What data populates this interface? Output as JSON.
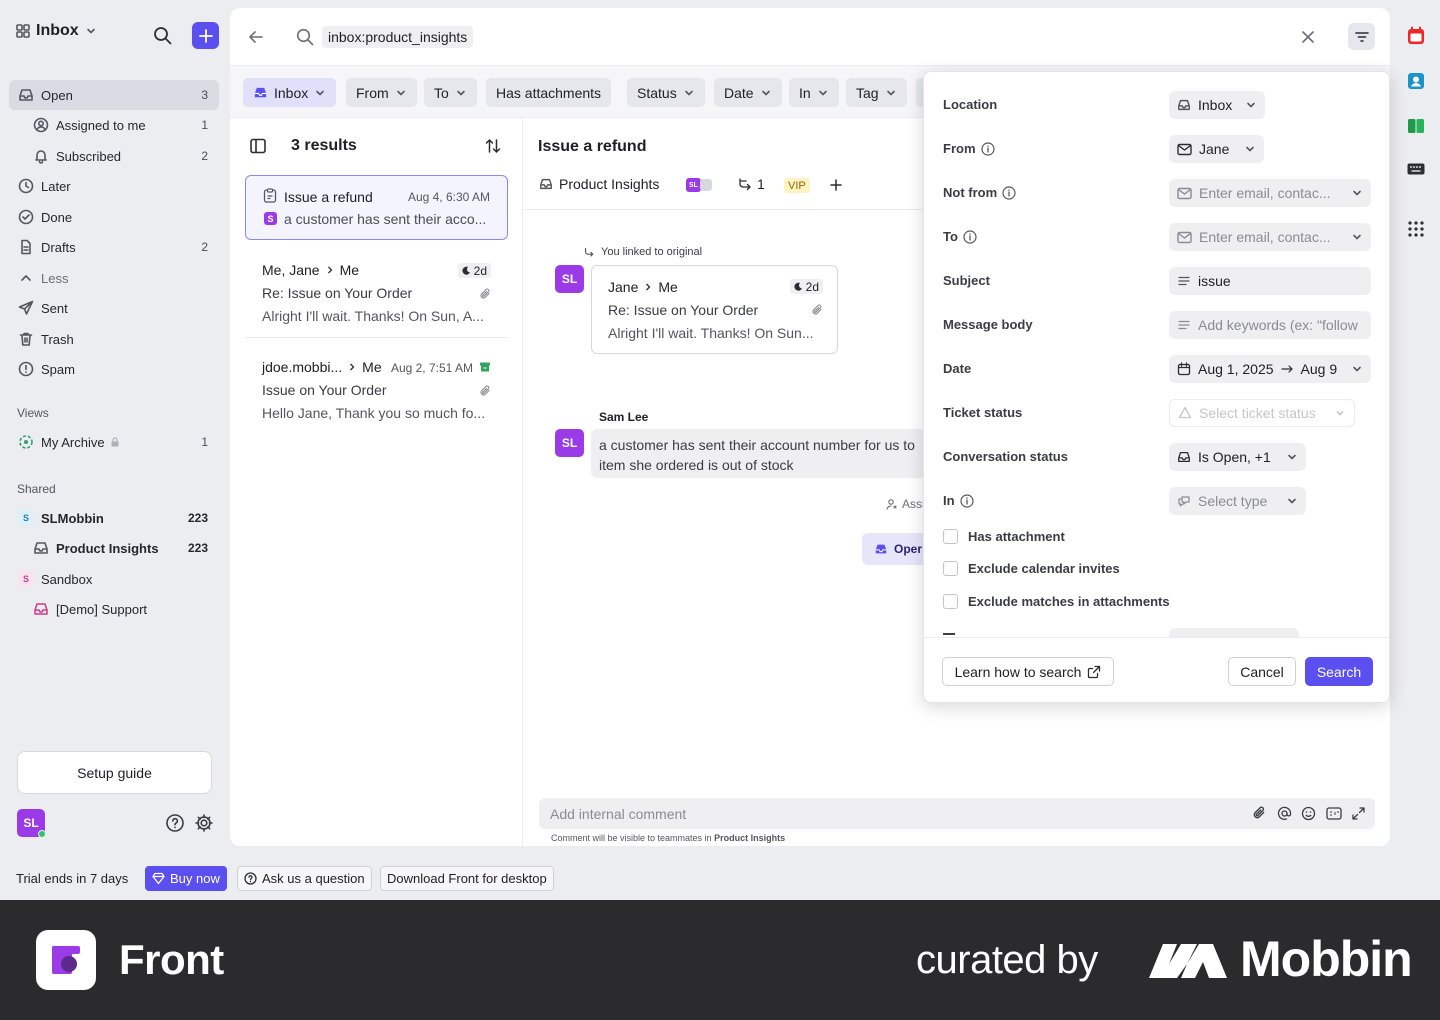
{
  "sidebar": {
    "title": "Inbox",
    "items": [
      {
        "label": "Open",
        "count": "3"
      },
      {
        "label": "Assigned to me",
        "count": "1"
      },
      {
        "label": "Subscribed",
        "count": "2"
      },
      {
        "label": "Later",
        "count": ""
      },
      {
        "label": "Done",
        "count": ""
      },
      {
        "label": "Drafts",
        "count": "2"
      },
      {
        "label": "Less",
        "count": ""
      },
      {
        "label": "Sent",
        "count": ""
      },
      {
        "label": "Trash",
        "count": ""
      },
      {
        "label": "Spam",
        "count": ""
      }
    ],
    "views_heading": "Views",
    "views": [
      {
        "label": "My Archive",
        "count": "1"
      }
    ],
    "shared_heading": "Shared",
    "shared": [
      {
        "label": "SLMobbin",
        "count": "223"
      },
      {
        "label": "Product Insights",
        "count": "223"
      },
      {
        "label": "Sandbox",
        "count": ""
      },
      {
        "label": "[Demo] Support",
        "count": ""
      }
    ],
    "setup_guide": "Setup guide",
    "avatar_initials": "SL"
  },
  "trial": {
    "text": "Trial ends in 7 days",
    "buy_now": "Buy now",
    "ask": "Ask us a question",
    "download": "Download Front for desktop"
  },
  "search": {
    "query": "inbox:product_insights"
  },
  "chips": [
    "Inbox",
    "From",
    "To",
    "Has attachments",
    "Status",
    "Date",
    "In",
    "Tag"
  ],
  "results": {
    "count_label": "3 results",
    "items": [
      {
        "from": "Issue a refund",
        "date": "Aug 4, 6:30 AM",
        "subject": "",
        "preview": "a customer has sent their acco..."
      },
      {
        "from": "Me, Jane",
        "to": "Me",
        "date": "2d",
        "subject": "Re: Issue on Your Order",
        "preview": "Alright I'll wait. Thanks! On Sun, A..."
      },
      {
        "from": "jdoe.mobbi...",
        "to": "Me",
        "date": "Aug 2, 7:51 AM",
        "subject": "Issue on Your Order",
        "preview": "Hello Jane, Thank you so much fo..."
      }
    ]
  },
  "conversation": {
    "title": "Issue a refund",
    "inbox": "Product Insights",
    "avatar_initials": "SL",
    "link_count": "1",
    "tag": "VIP",
    "linked_note": "You linked to original",
    "linked_card": {
      "from": "Jane",
      "to": "Me",
      "time": "2d",
      "subject": "Re: Issue on Your Order",
      "preview": "Alright I'll wait. Thanks! On Sun..."
    },
    "author": "Sam Lee",
    "message": "a customer has sent their account number for us to item she ordered is out of stock",
    "message_line1": "a customer has sent their account number for us to",
    "message_line2": "item she ordered is out of stock",
    "assign_partial": "Assi",
    "status_partial": "Oper",
    "comment_placeholder": "Add internal comment",
    "comment_note": "Comment will be visible to teammates in",
    "comment_note_inbox": "Product Insights"
  },
  "filter": {
    "rows": [
      {
        "label": "Location",
        "value": "Inbox"
      },
      {
        "label": "From",
        "value": "Jane"
      },
      {
        "label": "Not from",
        "placeholder": "Enter email, contac..."
      },
      {
        "label": "To",
        "placeholder": "Enter email, contac..."
      },
      {
        "label": "Subject",
        "value": "issue"
      },
      {
        "label": "Message body",
        "placeholder": "Add keywords (ex: \"follow"
      },
      {
        "label": "Date",
        "value_from": "Aug 1, 2025",
        "value_to": "Aug 9"
      },
      {
        "label": "Ticket status",
        "placeholder": "Select ticket status"
      },
      {
        "label": "Conversation status",
        "value": "Is Open, +1"
      },
      {
        "label": "In",
        "placeholder": "Select type"
      }
    ],
    "checkboxes": [
      "Has attachment",
      "Exclude calendar invites",
      "Exclude matches in attachments"
    ],
    "learn": "Learn how to search",
    "cancel": "Cancel",
    "search": "Search"
  },
  "footer": {
    "brand": "Front",
    "curated": "curated by",
    "mobbin": "Mobbin"
  },
  "colors": {
    "accent": "#5b4ff0",
    "avatar": "#9b3be8",
    "footer_bg": "#2b2b2d"
  }
}
